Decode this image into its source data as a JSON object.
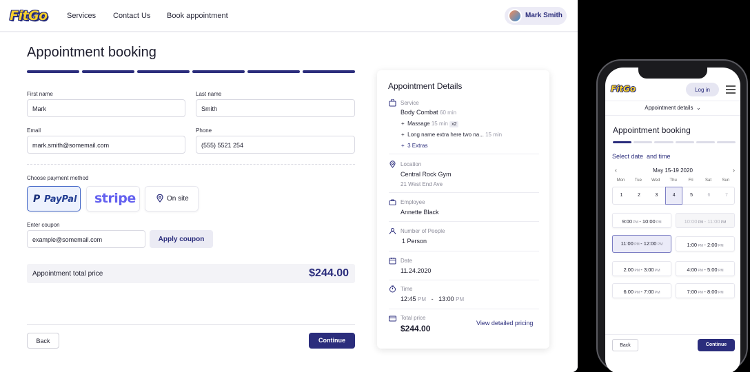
{
  "brand": {
    "logo": "FitGo",
    "primary_color": "#2b2d7c",
    "accent_color": "#f6cf2c"
  },
  "nav": {
    "items": [
      "Services",
      "Contact Us",
      "Book appointment"
    ]
  },
  "user": {
    "name": "Mark Smith"
  },
  "page": {
    "title": "Appointment booking",
    "steps_total": 6,
    "steps_completed": 6
  },
  "form": {
    "first_name": {
      "label": "First name",
      "value": "Mark"
    },
    "last_name": {
      "label": "Last name",
      "value": "Smith"
    },
    "email": {
      "label": "Email",
      "value": "mark.smith@somemail.com"
    },
    "phone": {
      "label": "Phone",
      "value": "(555) 5521 254"
    },
    "payment": {
      "label": "Choose payment method",
      "options": [
        "PayPal",
        "stripe",
        "On site"
      ],
      "selected": "PayPal"
    },
    "coupon": {
      "label": "Enter coupon",
      "value": "example@somemail.com",
      "button": "Apply coupon"
    },
    "total": {
      "label": "Appointment total price",
      "value": "$244.00"
    },
    "back_button": "Back",
    "continue_button": "Continue"
  },
  "details": {
    "title": "Appointment Details",
    "service": {
      "label": "Service",
      "name": "Body Combat",
      "duration": "60 min",
      "extras": [
        {
          "name": "Massage",
          "duration": "15 min",
          "qty": "x2"
        },
        {
          "name": "Long name extra here two na...",
          "duration": "15 min"
        }
      ],
      "more_extras": "3 Extras"
    },
    "location": {
      "label": "Location",
      "name": "Central Rock Gym",
      "address": "21 West End Ave"
    },
    "employee": {
      "label": "Employee",
      "name": "Annette Black"
    },
    "people": {
      "label": "Number of People",
      "value": "1 Person"
    },
    "date": {
      "label": "Date",
      "value": "11.24.2020"
    },
    "time": {
      "label": "Time",
      "start": "12:45",
      "start_period": "PM",
      "end": "13:00",
      "end_period": "PM",
      "separator": "-"
    },
    "total": {
      "label": "Total price",
      "value": "$244.00",
      "link": "View detailed pricing"
    }
  },
  "mobile": {
    "logo": "FitGo",
    "login": "Log in",
    "details_dropdown": "Appointment details",
    "title": "Appointment booking",
    "steps_total": 6,
    "steps_completed": 1,
    "section": "Select date  and time",
    "month": "May 15-19 2020",
    "prev": "‹",
    "next": "›",
    "weekdays": [
      "Mon",
      "Tue",
      "Wed",
      "Thu",
      "Fri",
      "Sat",
      "Sun"
    ],
    "dates": [
      {
        "d": "1",
        "state": "normal"
      },
      {
        "d": "2",
        "state": "normal"
      },
      {
        "d": "3",
        "state": "normal"
      },
      {
        "d": "4",
        "state": "selected"
      },
      {
        "d": "5",
        "state": "normal"
      },
      {
        "d": "6",
        "state": "disabled"
      },
      {
        "d": "7",
        "state": "disabled"
      }
    ],
    "slots": [
      {
        "start": "9:00",
        "end": "10:00",
        "state": "normal"
      },
      {
        "start": "10:00",
        "end": "11:00",
        "state": "disabled"
      },
      {
        "start": "11:00",
        "end": "12:00",
        "state": "selected"
      },
      {
        "start": "1:00",
        "end": "2:00",
        "state": "normal"
      },
      {
        "start": "2:00",
        "end": "3:00",
        "state": "normal"
      },
      {
        "start": "4:00",
        "end": "5:00",
        "state": "normal"
      },
      {
        "start": "6:00",
        "end": "7:00",
        "state": "normal"
      },
      {
        "start": "7:00",
        "end": "8:00",
        "state": "normal"
      }
    ],
    "period": "PM",
    "back": "Back",
    "continue": "Continue"
  }
}
